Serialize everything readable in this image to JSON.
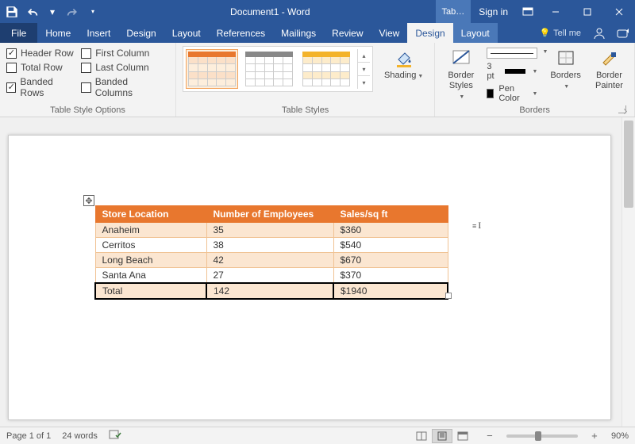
{
  "titlebar": {
    "doc_title": "Document1 - Word",
    "tabtools_label": "Tab…",
    "signin": "Sign in"
  },
  "tabs": {
    "file": "File",
    "list": [
      "Home",
      "Insert",
      "Design",
      "Layout",
      "References",
      "Mailings",
      "Review",
      "View"
    ],
    "tool_tabs": [
      "Design",
      "Layout"
    ],
    "active_tool_tab": "Design",
    "tellme": "Tell me"
  },
  "ribbon": {
    "style_options": {
      "group_label": "Table Style Options",
      "col1": [
        {
          "label": "Header Row",
          "checked": true
        },
        {
          "label": "Total Row",
          "checked": false
        },
        {
          "label": "Banded Rows",
          "checked": true
        }
      ],
      "col2": [
        {
          "label": "First Column",
          "checked": false
        },
        {
          "label": "Last Column",
          "checked": false
        },
        {
          "label": "Banded Columns",
          "checked": false
        }
      ]
    },
    "table_styles": {
      "group_label": "Table Styles",
      "shading": "Shading"
    },
    "borders": {
      "group_label": "Borders",
      "border_styles": "Border Styles",
      "weight": "3 pt",
      "pen_color": "Pen Color",
      "borders_btn": "Borders",
      "painter": "Border Painter"
    }
  },
  "document": {
    "table": {
      "headers": [
        "Store Location",
        "Number of Employees",
        "Sales/sq ft"
      ],
      "rows": [
        [
          "Anaheim",
          "35",
          "$360"
        ],
        [
          "Cerritos",
          "38",
          "$540"
        ],
        [
          "Long Beach",
          "42",
          "$670"
        ],
        [
          "Santa Ana",
          "27",
          "$370"
        ]
      ],
      "total_row": [
        "Total",
        "142",
        "$1940"
      ]
    }
  },
  "statusbar": {
    "page": "Page 1 of 1",
    "words": "24 words",
    "zoom": "90%"
  }
}
